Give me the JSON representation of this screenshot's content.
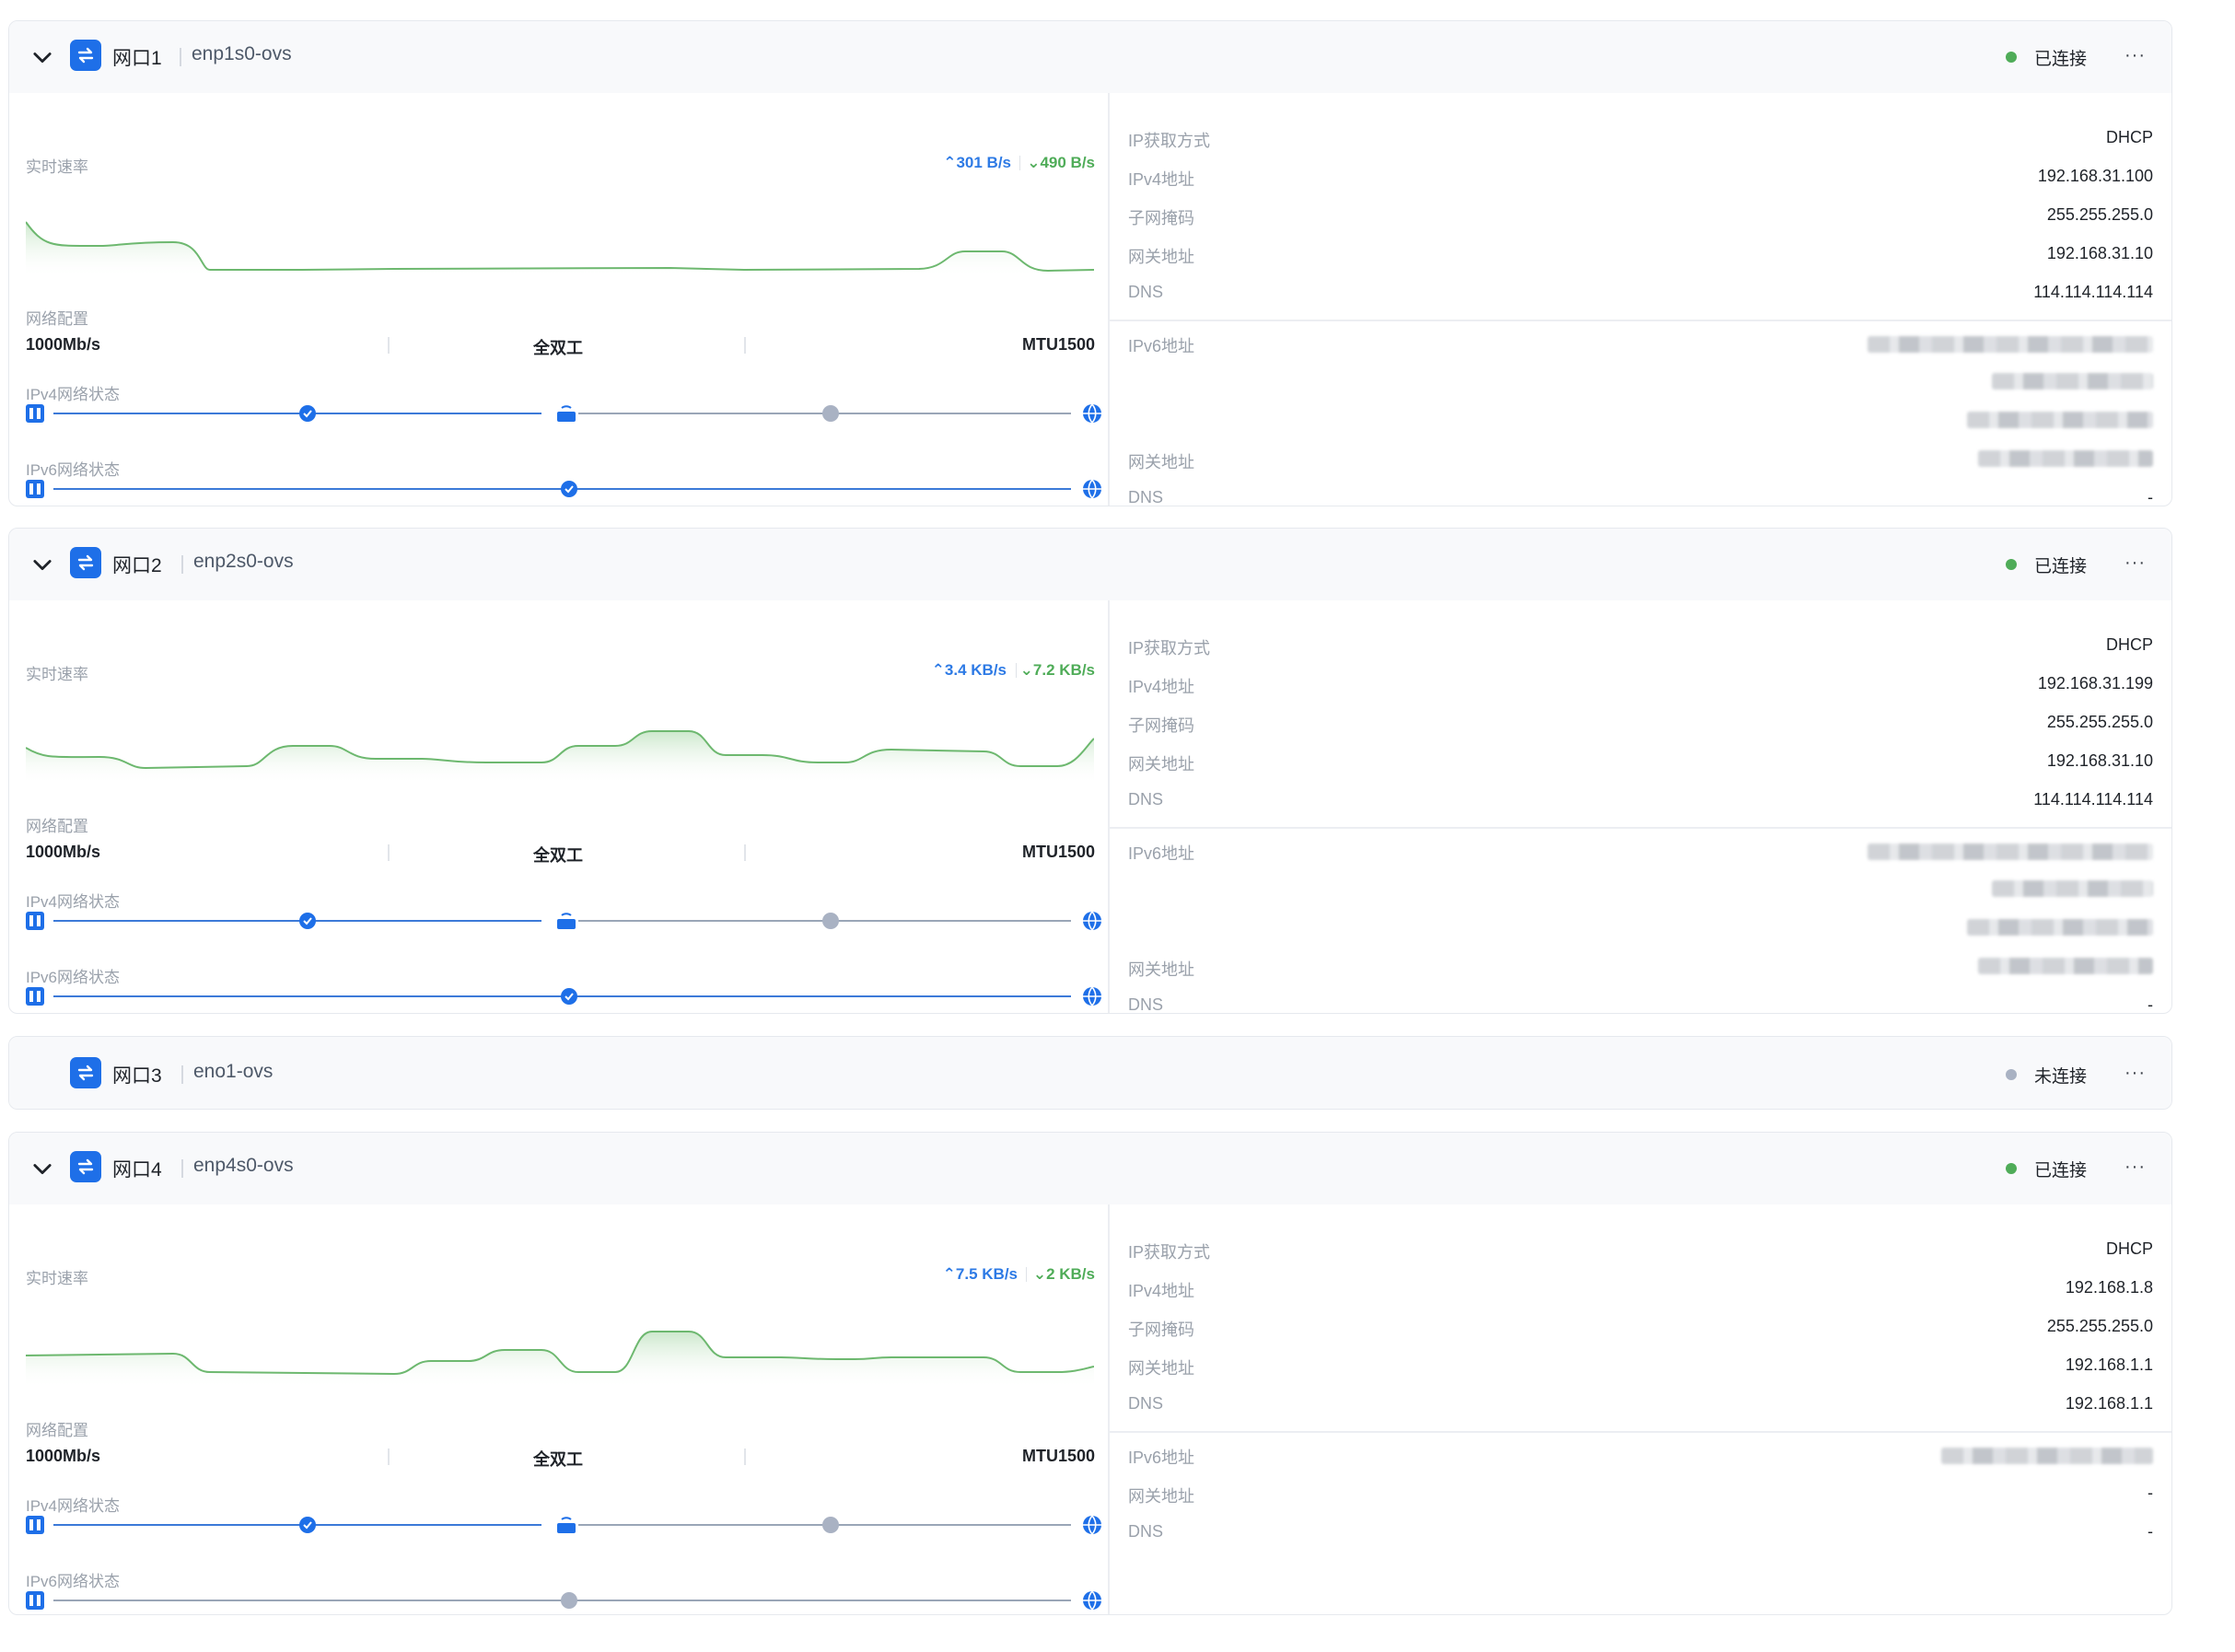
{
  "ports": [
    {
      "name": "网口1",
      "device": "enp1s0-ovs",
      "expanded": true,
      "status": "已连接",
      "status_color": "#4fac58",
      "more": "···",
      "speed_label": "实时速率",
      "up": "301 B/s",
      "down": "490 B/s",
      "config_label": "网络配置",
      "link_speed": "1000Mb/s",
      "duplex": "全双工",
      "mtu": "MTU1500",
      "ipv4_state_label": "IPv4网络状态",
      "ipv6_state_label": "IPv6网络状态",
      "ipv4_state": "local-connected",
      "ipv6_state": "local-connected",
      "ip_rows": [
        {
          "k": "IP获取方式",
          "v": "DHCP"
        },
        {
          "k": "IPv4地址",
          "v": "192.168.31.100"
        },
        {
          "k": "子网掩码",
          "v": "255.255.255.0"
        },
        {
          "k": "网关地址",
          "v": "192.168.31.10"
        },
        {
          "k": "DNS",
          "v": "114.114.114.114"
        }
      ],
      "ipv6_label": "IPv6地址",
      "ipv6_gw_label": "网关地址",
      "ipv6_dns_label": "DNS",
      "ipv6_gw": "",
      "ipv6_dns": "-"
    },
    {
      "name": "网口2",
      "device": "enp2s0-ovs",
      "expanded": true,
      "status": "已连接",
      "status_color": "#4fac58",
      "more": "···",
      "speed_label": "实时速率",
      "up": "3.4 KB/s",
      "down": "7.2 KB/s",
      "config_label": "网络配置",
      "link_speed": "1000Mb/s",
      "duplex": "全双工",
      "mtu": "MTU1500",
      "ipv4_state_label": "IPv4网络状态",
      "ipv6_state_label": "IPv6网络状态",
      "ipv4_state": "local-connected",
      "ipv6_state": "local-connected",
      "ip_rows": [
        {
          "k": "IP获取方式",
          "v": "DHCP"
        },
        {
          "k": "IPv4地址",
          "v": "192.168.31.199"
        },
        {
          "k": "子网掩码",
          "v": "255.255.255.0"
        },
        {
          "k": "网关地址",
          "v": "192.168.31.10"
        },
        {
          "k": "DNS",
          "v": "114.114.114.114"
        }
      ],
      "ipv6_label": "IPv6地址",
      "ipv6_gw_label": "网关地址",
      "ipv6_dns_label": "DNS",
      "ipv6_gw": "",
      "ipv6_dns": "-"
    },
    {
      "name": "网口3",
      "device": "eno1-ovs",
      "expanded": false,
      "status": "未连接",
      "status_color": "#a9b2c3",
      "more": "···"
    },
    {
      "name": "网口4",
      "device": "enp4s0-ovs",
      "expanded": true,
      "status": "已连接",
      "status_color": "#4fac58",
      "more": "···",
      "speed_label": "实时速率",
      "up": "7.5 KB/s",
      "down": "2 KB/s",
      "config_label": "网络配置",
      "link_speed": "1000Mb/s",
      "duplex": "全双工",
      "mtu": "MTU1500",
      "ipv4_state_label": "IPv4网络状态",
      "ipv6_state_label": "IPv6网络状态",
      "ipv4_state": "local-connected",
      "ipv6_state": "not-connected",
      "ip_rows": [
        {
          "k": "IP获取方式",
          "v": "DHCP"
        },
        {
          "k": "IPv4地址",
          "v": "192.168.1.8"
        },
        {
          "k": "子网掩码",
          "v": "255.255.255.0"
        },
        {
          "k": "网关地址",
          "v": "192.168.1.1"
        },
        {
          "k": "DNS",
          "v": "192.168.1.1"
        }
      ],
      "ipv6_label": "IPv6地址",
      "ipv6_gw_label": "网关地址",
      "ipv6_dns_label": "DNS",
      "ipv6_gw": "-",
      "ipv6_dns": "-"
    }
  ],
  "icons": {
    "expand": "chevron-down-icon",
    "port": "port-swap-icon",
    "nic": "nic-icon",
    "router": "router-icon",
    "internet": "globe-icon",
    "check": "check-circle-icon"
  },
  "colors": {
    "accent": "#1e6fe8",
    "up": "#2d7ae5",
    "down": "#4fac58",
    "chart_line": "#6db86f",
    "offline": "#a9b2c3"
  }
}
